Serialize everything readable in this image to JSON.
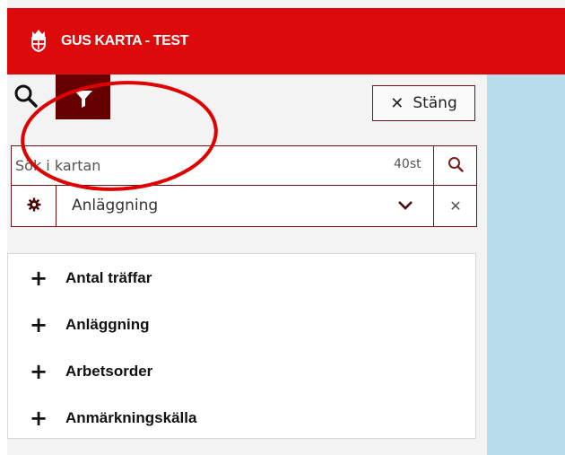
{
  "header": {
    "title": "GUS KARTA - TEST",
    "logo_icon": "crown-shield-icon",
    "background_color": "#dc0a0a"
  },
  "toolbar": {
    "search_tab_icon": "search-icon",
    "filter_tab_icon": "filter-icon",
    "filter_tab_color": "#660000",
    "close_label": "Stäng",
    "close_icon": "close-icon"
  },
  "search": {
    "placeholder": "Sök i kartan",
    "value": "",
    "count": "40st",
    "button_icon": "search-icon"
  },
  "layer_select": {
    "settings_icon": "gear-icon",
    "selected": "Anläggning",
    "chevron_icon": "chevron-down-icon",
    "clear_icon": "close-icon"
  },
  "filters": {
    "items": [
      {
        "label": "Antal träffar",
        "icon": "plus-icon"
      },
      {
        "label": "Anläggning",
        "icon": "plus-icon"
      },
      {
        "label": "Arbetsorder",
        "icon": "plus-icon"
      },
      {
        "label": "Anmärkningskälla",
        "icon": "plus-icon"
      }
    ]
  },
  "map": {
    "background_color": "#b8dcea"
  },
  "annotation": {
    "shape": "ellipse",
    "color": "#e00000"
  }
}
